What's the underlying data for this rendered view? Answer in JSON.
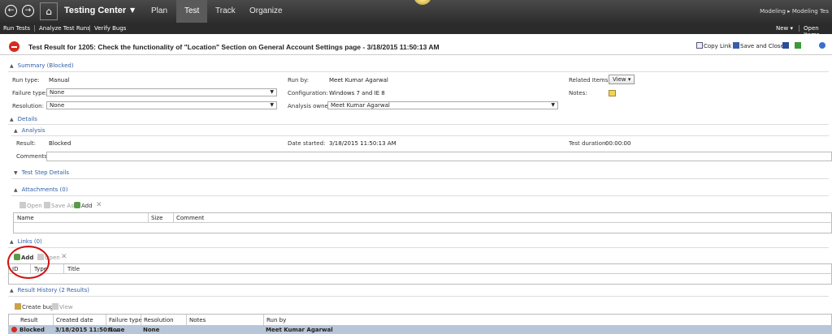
{
  "topbar": {
    "app_name": "Testing Center",
    "tabs": [
      "Plan",
      "Test",
      "Track",
      "Organize"
    ],
    "active_tab": "Test",
    "breadcrumb": "Modeling ▸ Modeling Tes"
  },
  "toolbar": {
    "run_tests": "Run Tests",
    "analyze_test_runs": "Analyze Test Runs",
    "verify_bugs": "Verify Bugs",
    "new": "New ▾",
    "open_items": "Open Items"
  },
  "header": {
    "title": "Test Result for 1205: Check the functionality of \"Location\" Section on General Account Settings page - 3/18/2015 11:50:13 AM",
    "copy_link": "Copy Link",
    "save_and_close": "Save and Close"
  },
  "summary": {
    "section_label": "Summary (Blocked)",
    "run_type_label": "Run type:",
    "run_type_value": "Manual",
    "failure_type_label": "Failure type:",
    "failure_type_value": "None",
    "resolution_label": "Resolution:",
    "resolution_value": "None",
    "run_by_label": "Run by:",
    "run_by_value": "Meet Kumar Agarwal",
    "configuration_label": "Configuration:",
    "configuration_value": "Windows 7 and IE 8",
    "analysis_owner_label": "Analysis owner:",
    "analysis_owner_value": "Meet Kumar Agarwal",
    "related_items_label": "Related Items:",
    "view_button": "View ▾",
    "notes_label": "Notes:"
  },
  "details": {
    "section_label": "Details",
    "analysis_label": "Analysis",
    "result_label": "Result:",
    "result_value": "Blocked",
    "date_started_label": "Date started:",
    "date_started_value": "3/18/2015 11:50:13 AM",
    "test_duration_label": "Test duration:",
    "test_duration_value": "00:00:00",
    "comments_label": "Comments:",
    "test_step_details_label": "Test Step Details"
  },
  "attachments": {
    "section_label": "Attachments (0)",
    "open": "Open",
    "save_as": "Save As",
    "add": "Add",
    "columns": [
      "Name",
      "Size",
      "Comment"
    ]
  },
  "links": {
    "section_label": "Links (0)",
    "add": "Add",
    "open": "Open",
    "columns": [
      "ID",
      "Type",
      "Title"
    ]
  },
  "result_history": {
    "section_label": "Result History (2 Results)",
    "create_bug": "Create bug",
    "view": "View",
    "columns": [
      "Result",
      "Created date",
      "Failure type",
      "Resolution",
      "Notes",
      "Run by"
    ],
    "rows": [
      {
        "result": "Blocked",
        "created": "3/18/2015 11:50:1...",
        "failure_type": "None",
        "resolution": "None",
        "notes": "",
        "run_by": "Meet Kumar Agarwal"
      }
    ]
  }
}
